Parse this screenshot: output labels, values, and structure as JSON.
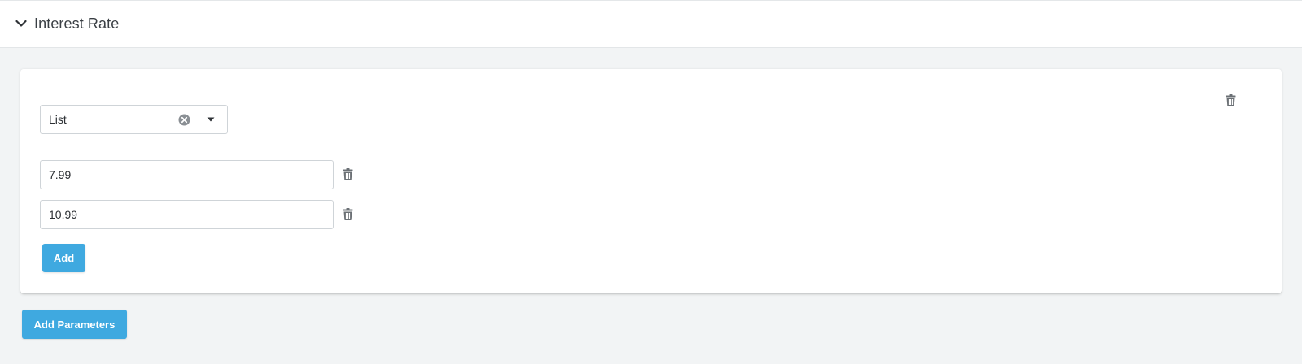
{
  "section": {
    "title": "Interest Rate",
    "expanded_icon": "chevron-down-icon"
  },
  "parameter": {
    "type_select": {
      "value": "List",
      "clear_icon": "clear-circle-icon",
      "caret_icon": "caret-down-icon"
    },
    "delete_icon": "trash-icon",
    "values": [
      {
        "value": "7.99"
      },
      {
        "value": "10.99"
      }
    ],
    "add_label": "Add"
  },
  "footer": {
    "add_parameters_label": "Add Parameters"
  },
  "colors": {
    "primary_button": "#3fa9e0",
    "page_background": "#f2f4f5",
    "icon_gray": "#6b7075"
  }
}
